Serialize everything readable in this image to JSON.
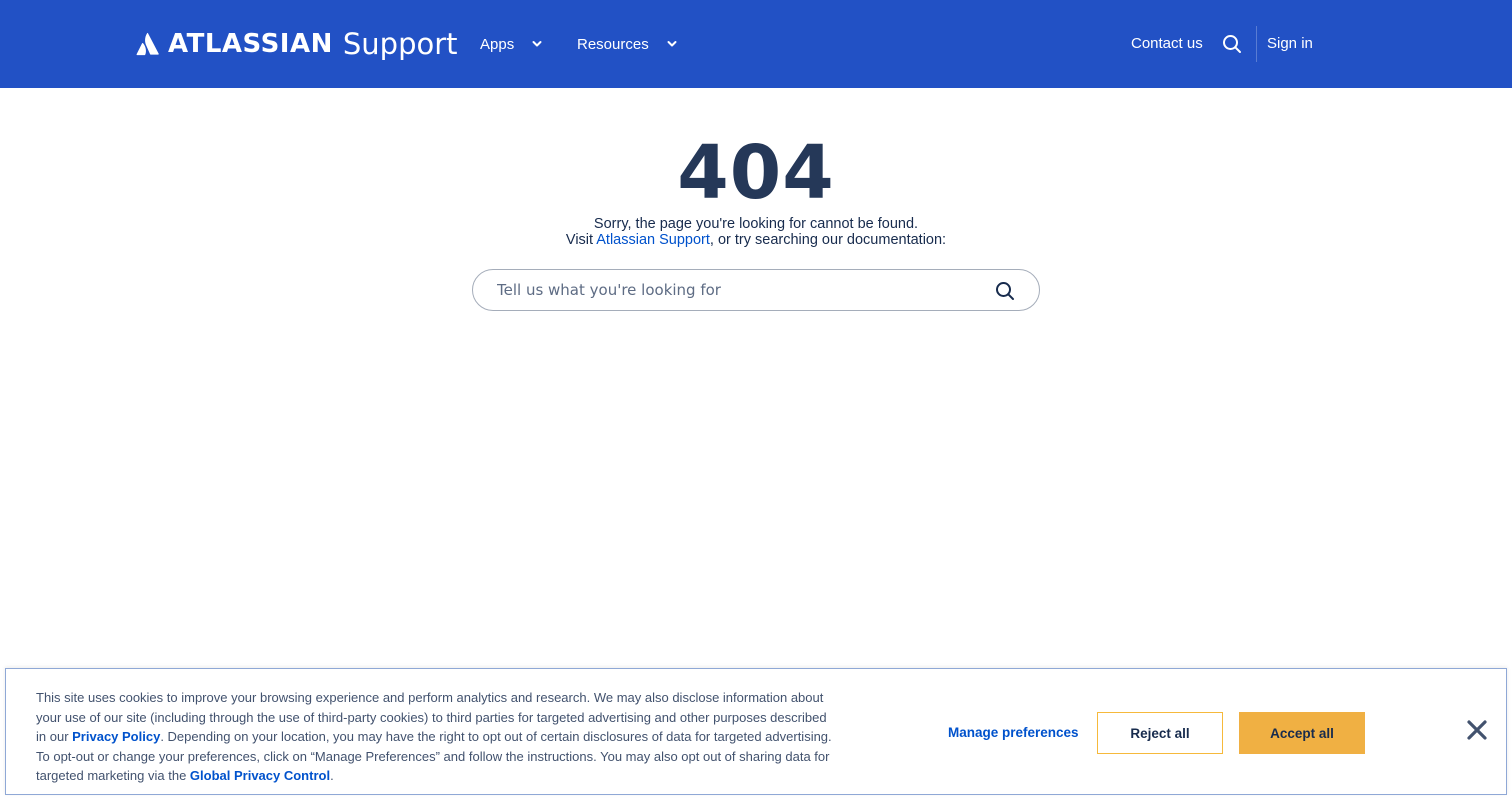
{
  "header": {
    "brand": "ATLASSIAN",
    "product": "Support",
    "nav": [
      {
        "label": "Apps"
      },
      {
        "label": "Resources"
      }
    ],
    "contact_label": "Contact us",
    "signin_label": "Sign in",
    "bg_color": "#2251c5"
  },
  "main": {
    "error_code": "404",
    "message_line1": "Sorry, the page you're looking for cannot be found.",
    "message_line2_prefix": "Visit ",
    "message_line2_link": "Atlassian Support",
    "message_line2_suffix": ", or try searching our documentation:",
    "search_placeholder": "Tell us what you're looking for"
  },
  "cookie_banner": {
    "text_part1": "This site uses cookies to improve your browsing experience and perform analytics and research. We may also disclose information about your use of our site (including through the use of third-party cookies) to third parties for targeted advertising and other purposes described in our ",
    "privacy_link": "Privacy Policy",
    "text_part2": ". Depending on your location, you may have the right to opt out of certain disclosures of data for targeted advertising. To opt-out or change your preferences, click on “Manage Preferences” and follow the instructions. You may also opt out of sharing data for targeted marketing via the ",
    "gpc_link": "Global Privacy Control",
    "text_part3": ".",
    "manage_label": "Manage preferences",
    "reject_label": "Reject all",
    "accept_label": "Accept all",
    "accept_color": "#f0b043"
  }
}
